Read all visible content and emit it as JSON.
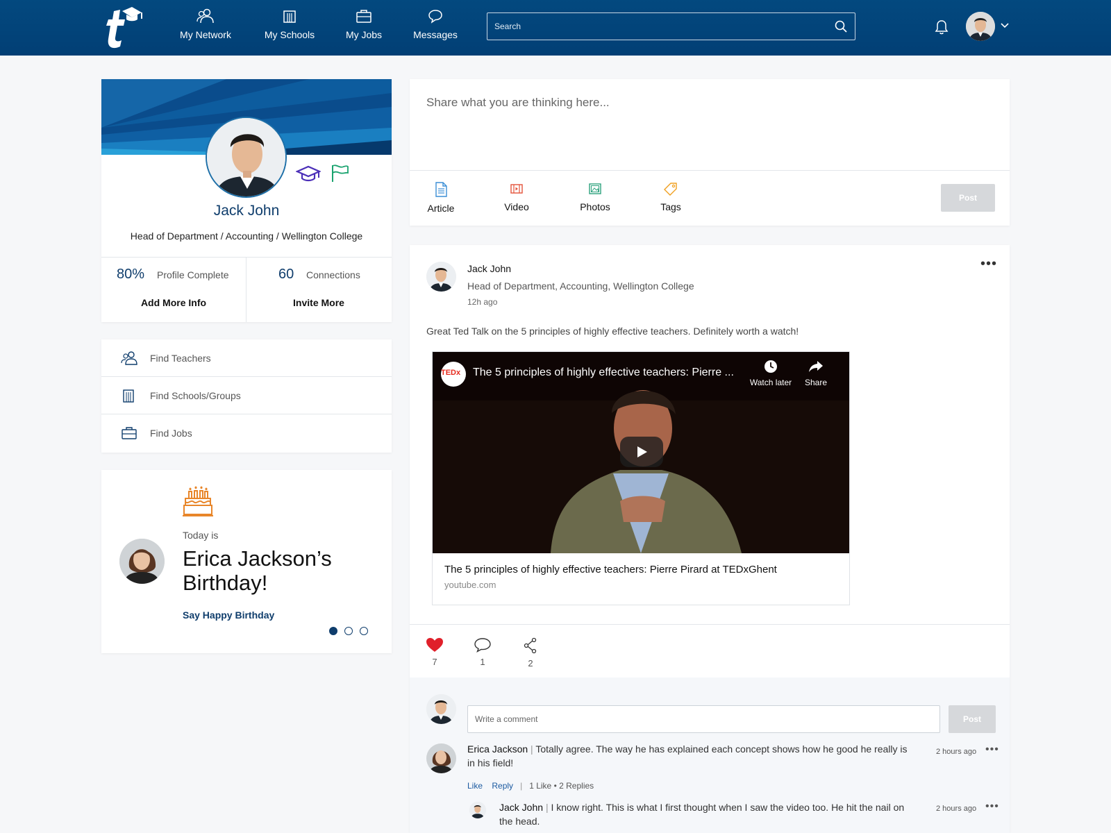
{
  "nav": {
    "items": [
      {
        "label": "My Network",
        "icon": "network-icon"
      },
      {
        "label": "My Schools",
        "icon": "school-icon"
      },
      {
        "label": "My Jobs",
        "icon": "briefcase-icon"
      },
      {
        "label": "Messages",
        "icon": "messages-icon"
      }
    ],
    "search_placeholder": "Search"
  },
  "profile": {
    "name": "Jack John",
    "title": "Head of Department / Accounting / Wellington College",
    "stats": [
      {
        "value": "80%",
        "label": "Profile Complete",
        "action": "Add More Info"
      },
      {
        "value": "60",
        "label": "Connections",
        "action": "Invite More"
      }
    ]
  },
  "find": {
    "items": [
      {
        "label": "Find Teachers",
        "icon": "teachers-icon"
      },
      {
        "label": "Find Schools/Groups",
        "icon": "school-icon"
      },
      {
        "label": "Find Jobs",
        "icon": "briefcase-icon"
      }
    ]
  },
  "birthday": {
    "today_label": "Today is",
    "headline": "Erica Jackson’s Birthday!",
    "action": "Say Happy Birthday"
  },
  "composer": {
    "placeholder": "Share what you are thinking here...",
    "tools": [
      "Article",
      "Video",
      "Photos",
      "Tags"
    ],
    "post_label": "Post"
  },
  "post": {
    "author": "Jack John",
    "subtitle": "Head of Department, Accounting, Wellington College",
    "time": "12h ago",
    "text": "Great Ted Talk on the 5 principles of highly effective teachers. Definitely worth a watch!",
    "video": {
      "logo_text": "TEDx",
      "title": "The 5 principles of highly effective teachers: Pierre ...",
      "watch_later": "Watch later",
      "share": "Share"
    },
    "embed_title": "The 5 principles of highly effective teachers: Pierre Pirard at TEDxGhent",
    "embed_source": "youtube.com",
    "reactions": {
      "likes": "7",
      "comments": "1",
      "shares": "2"
    },
    "comment_placeholder": "Write a comment",
    "comment_post_label": "Post",
    "comments": [
      {
        "author": "Erica Jackson",
        "text": "Totally agree. The way he has explained each concept shows how he good he really is in his field!",
        "time": "2 hours ago",
        "like": "Like",
        "reply": "Reply",
        "likes_count": "1 Like",
        "replies_count": "2 Replies"
      },
      {
        "author": "Jack John",
        "text": "I know right. This is what I first thought when I saw the video too. He hit the nail on the head.",
        "time": "2 hours ago"
      }
    ]
  },
  "colors": {
    "brand": "#03497f",
    "name_blue": "#0f3d6c",
    "heart_red": "#e0202a"
  }
}
